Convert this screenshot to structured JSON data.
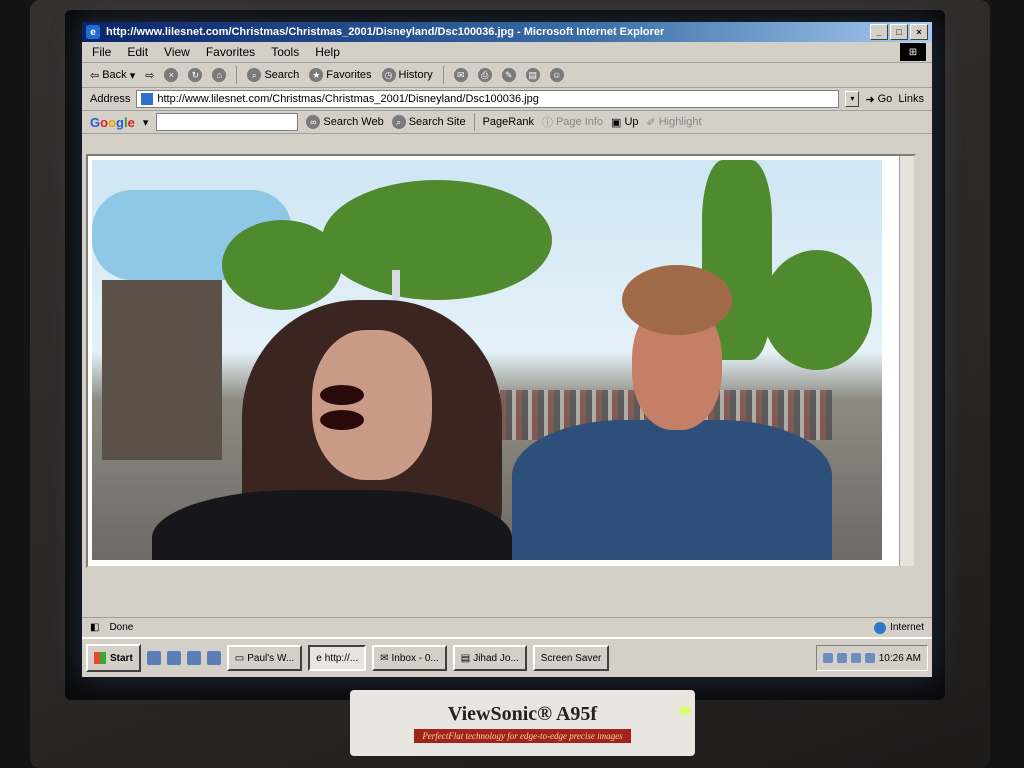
{
  "window": {
    "title": "http://www.lilesnet.com/Christmas/Christmas_2001/Disneyland/Dsc100036.jpg - Microsoft Internet Explorer",
    "icon": "ie-icon"
  },
  "menu": [
    "File",
    "Edit",
    "View",
    "Favorites",
    "Tools",
    "Help"
  ],
  "toolbar": {
    "back": "Back",
    "search": "Search",
    "favorites": "Favorites",
    "history": "History"
  },
  "address": {
    "label": "Address",
    "url": "http://www.lilesnet.com/Christmas/Christmas_2001/Disneyland/Dsc100036.jpg",
    "go": "Go",
    "links": "Links"
  },
  "google_toolbar": {
    "logo": [
      "G",
      "o",
      "o",
      "g",
      "l",
      "e"
    ],
    "search_web": "Search Web",
    "search_site": "Search Site",
    "pagerank": "PageRank",
    "page_info": "Page Info",
    "up": "Up",
    "highlight": "Highlight"
  },
  "status": {
    "text": "Done",
    "zone": "Internet"
  },
  "taskbar": {
    "start": "Start",
    "tasks": [
      "Paul's W...",
      "http://...",
      "Inbox - 0...",
      "Jihad Jo...",
      "Screen Saver"
    ],
    "clock": "10:26 AM"
  },
  "monitor": {
    "brand": "ViewSonic® A95f",
    "tagline": "PerfectFlat technology for edge-to-edge precise images"
  },
  "colors": {
    "titlebar_start": "#0a246a",
    "titlebar_end": "#a6caf0",
    "chrome": "#d4d0c8"
  }
}
